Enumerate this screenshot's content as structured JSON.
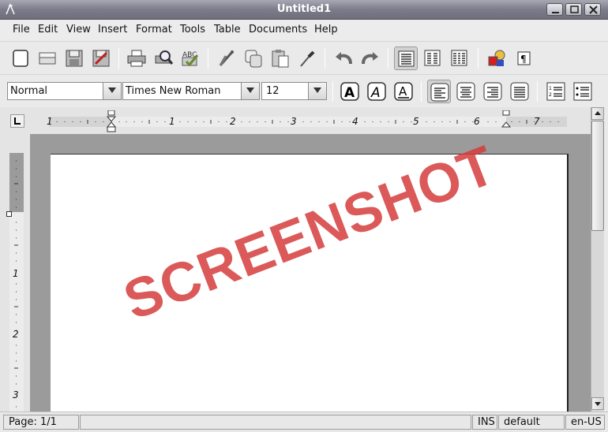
{
  "window": {
    "title": "Untitled1"
  },
  "menu": [
    "File",
    "Edit",
    "View",
    "Insert",
    "Format",
    "Tools",
    "Table",
    "Documents",
    "Help"
  ],
  "formatting": {
    "style": "Normal",
    "font": "Times New Roman",
    "size": "12"
  },
  "ruler": {
    "horizontal_labels": [
      "1",
      "1",
      "2",
      "3",
      "4",
      "5",
      "6",
      "7"
    ],
    "vertical_labels": [
      "1",
      "2",
      "3"
    ]
  },
  "watermark": "SCREENSHOT",
  "status": {
    "page": "Page: 1/1",
    "mode": "INS",
    "style": "default",
    "language": "en-US"
  },
  "colors": {
    "watermark": "#d53c3c",
    "titlebar": "#7c7c8a",
    "canvas": "#9b9b9b"
  }
}
